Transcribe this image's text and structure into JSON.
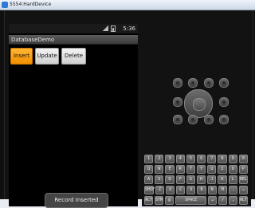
{
  "window": {
    "title": "5554:HardDevice"
  },
  "device": {
    "status_bar": {
      "time": "5:36"
    },
    "app": {
      "title": "DatabaseDemo",
      "buttons": {
        "insert": "Insert",
        "update": "Update",
        "delete": "Delete"
      },
      "toast": "Record Inserted"
    }
  },
  "keyboard": {
    "rows": [
      [
        "1",
        "2",
        "3",
        "4",
        "5",
        "6",
        "7",
        "8",
        "9",
        "0"
      ],
      [
        "Q",
        "W",
        "E",
        "R",
        "T",
        "Y",
        "U",
        "I",
        "O",
        "P"
      ],
      [
        "A",
        "S",
        "D",
        "F",
        "G",
        "H",
        "J",
        "K",
        "L",
        "DEL"
      ],
      [
        "SHIFT",
        "Z",
        "X",
        "C",
        "V",
        "B",
        "N",
        "M",
        ".",
        "↵"
      ],
      [
        "ALT",
        "SYM",
        "@",
        "SPACE",
        "↵",
        "/",
        ",",
        "ALT"
      ]
    ]
  }
}
